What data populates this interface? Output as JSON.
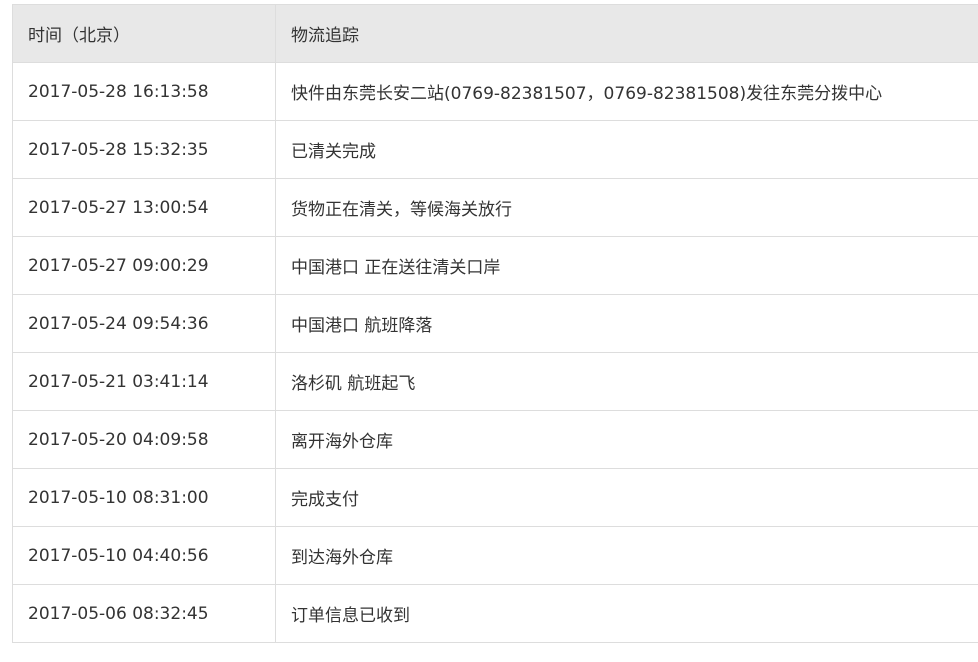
{
  "table": {
    "headers": {
      "time": "时间（北京）",
      "event": "物流追踪"
    },
    "rows": [
      {
        "time": "2017-05-28 16:13:58",
        "event": "快件由东莞长安二站(0769-82381507，0769-82381508)发往东莞分拨中心"
      },
      {
        "time": "2017-05-28 15:32:35",
        "event": "已清关完成"
      },
      {
        "time": "2017-05-27 13:00:54",
        "event": "货物正在清关，等候海关放行"
      },
      {
        "time": "2017-05-27 09:00:29",
        "event": "中国港口 正在送往清关口岸"
      },
      {
        "time": "2017-05-24 09:54:36",
        "event": "中国港口 航班降落"
      },
      {
        "time": "2017-05-21 03:41:14",
        "event": "洛杉矶 航班起飞"
      },
      {
        "time": "2017-05-20 04:09:58",
        "event": "离开海外仓库"
      },
      {
        "time": "2017-05-10 08:31:00",
        "event": "完成支付"
      },
      {
        "time": "2017-05-10 04:40:56",
        "event": "到达海外仓库"
      },
      {
        "time": "2017-05-06 08:32:45",
        "event": "订单信息已收到"
      }
    ]
  },
  "colors": {
    "header_bg": "#e8e8e8",
    "border": "#dddddd",
    "text": "#333333"
  }
}
